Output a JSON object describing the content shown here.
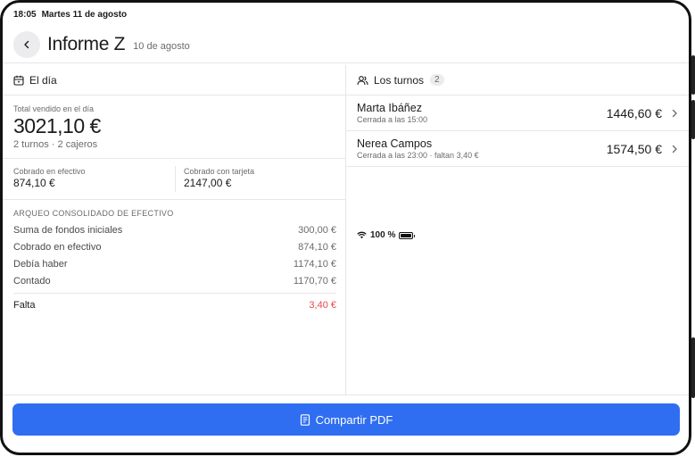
{
  "status_bar": {
    "time": "18:05",
    "date": "Martes 11 de agosto",
    "battery": "100 %"
  },
  "header": {
    "title": "Informe Z",
    "subtitle": "10 de agosto"
  },
  "day_section": {
    "title": "El día",
    "total_label": "Total vendido en el día",
    "total_value": "3021,10 €",
    "total_sub": "2 turnos · 2 cajeros",
    "cash_label": "Cobrado en efectivo",
    "cash_value": "874,10 €",
    "card_label": "Cobrado con tarjeta",
    "card_value": "2147,00 €",
    "arqueo_title": "ARQUEO CONSOLIDADO DE EFECTIVO",
    "arqueo_rows": [
      {
        "label": "Suma de fondos iniciales",
        "value": "300,00 €"
      },
      {
        "label": "Cobrado en efectivo",
        "value": "874,10 €"
      },
      {
        "label": "Debía haber",
        "value": "1174,10 €"
      },
      {
        "label": "Contado",
        "value": "1170,70 €"
      }
    ],
    "falta_label": "Falta",
    "falta_value": "3,40 €"
  },
  "shifts_section": {
    "title": "Los turnos",
    "count": "2",
    "shifts": [
      {
        "name": "Marta Ibáñez",
        "meta": "Cerrada a las 15:00",
        "amount": "1446,60 €"
      },
      {
        "name": "Nerea Campos",
        "meta": "Cerrada a las 23:00 · faltan 3,40 €",
        "amount": "1574,50 €"
      }
    ]
  },
  "footer": {
    "share_label": "Compartir PDF"
  },
  "colors": {
    "accent": "#2f6ef0",
    "danger": "#e5484d"
  }
}
